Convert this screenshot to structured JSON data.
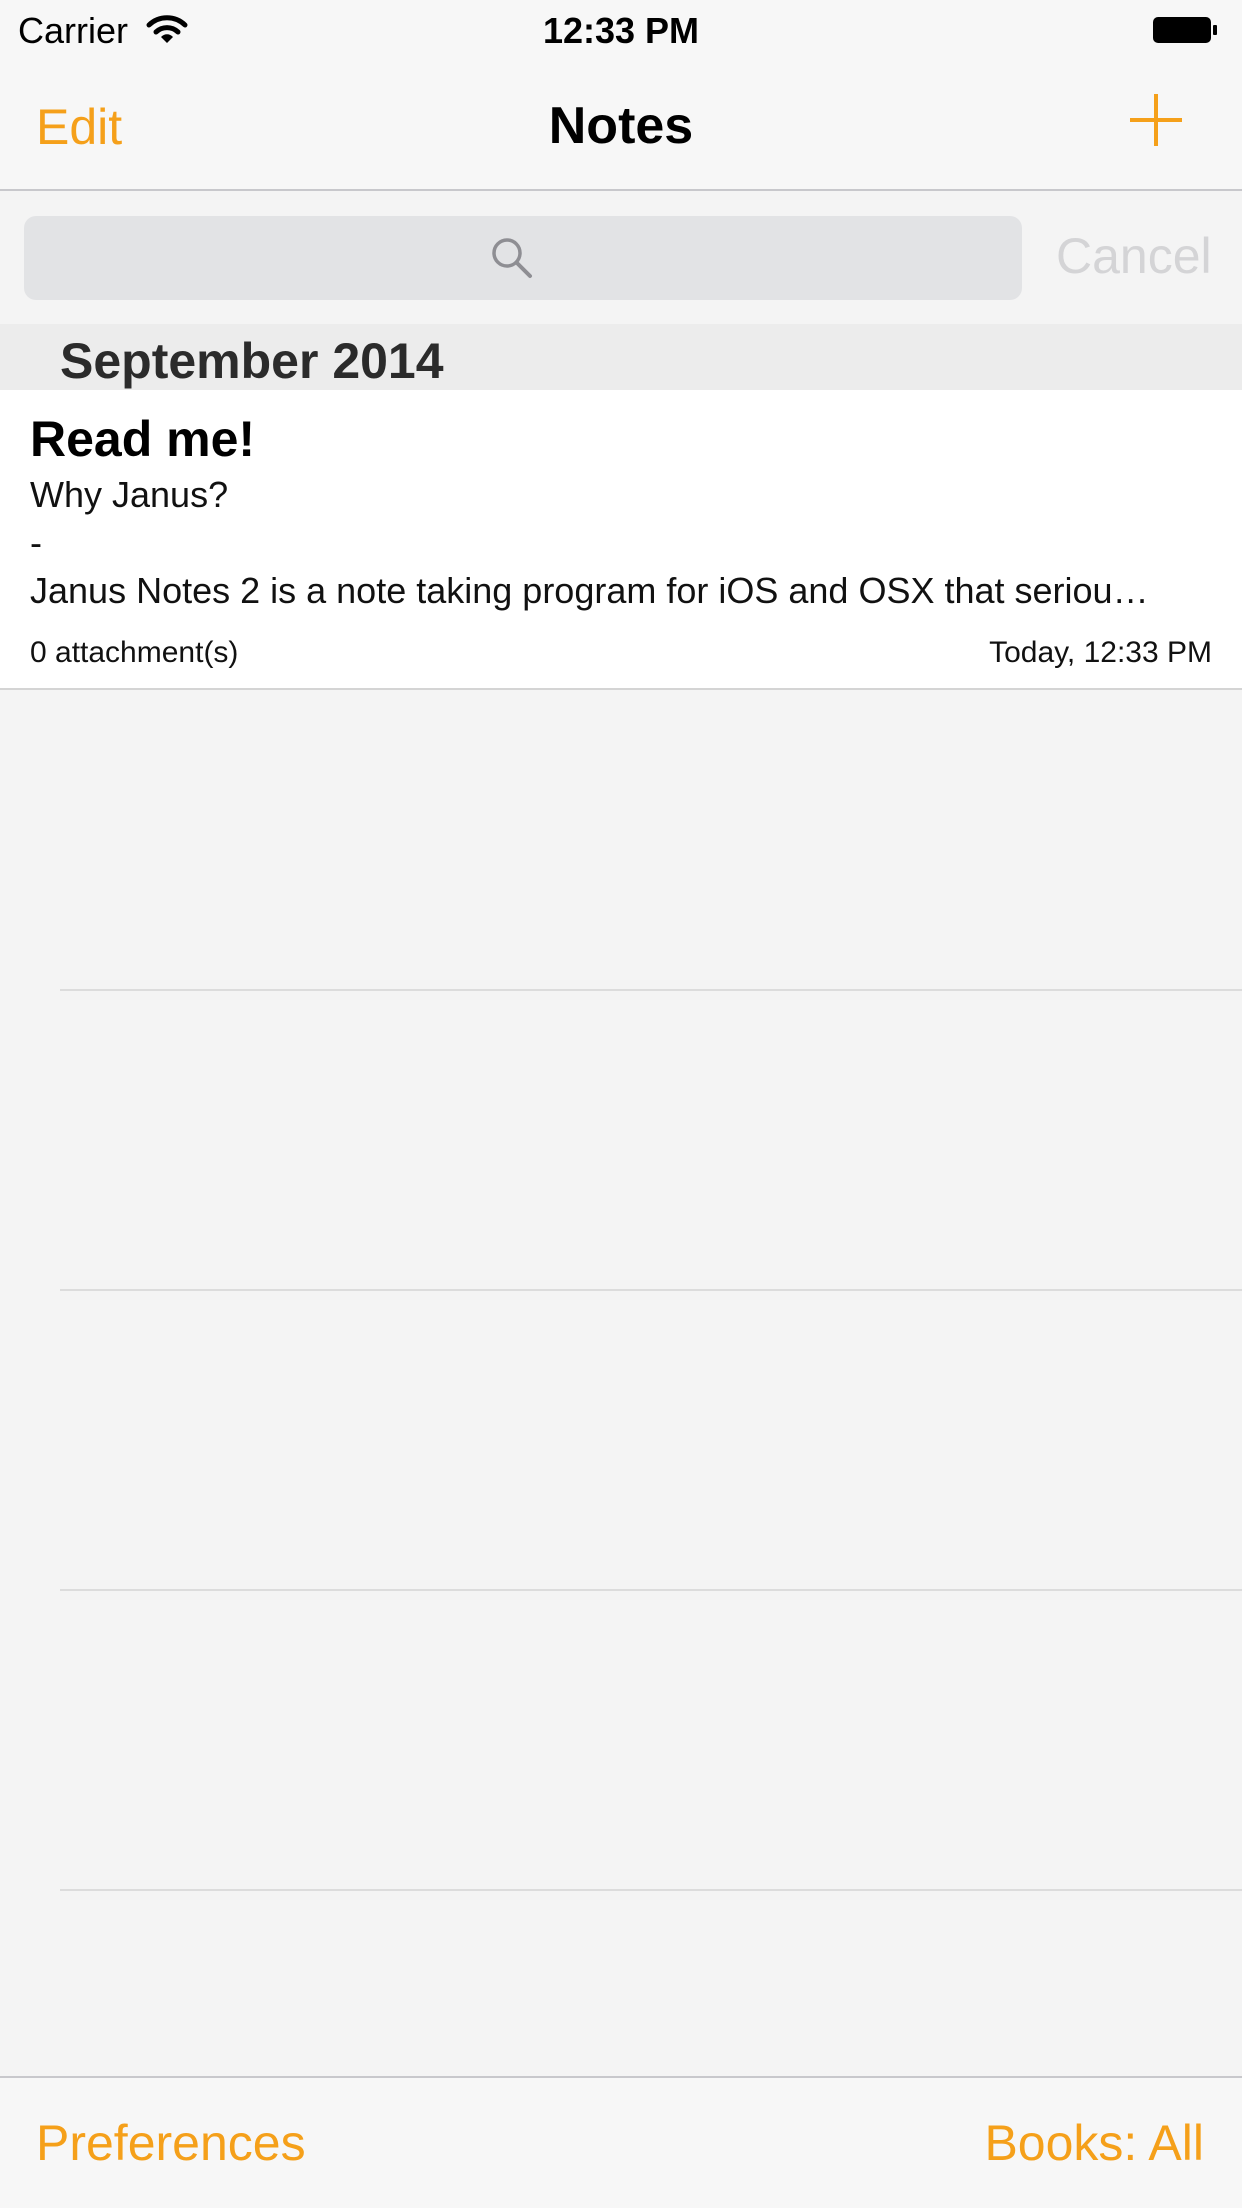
{
  "status_bar": {
    "carrier": "Carrier",
    "time": "12:33 PM"
  },
  "nav": {
    "left_label": "Edit",
    "title": "Notes",
    "right_icon": "plus-icon"
  },
  "search": {
    "placeholder": "",
    "cancel_label": "Cancel",
    "icon": "search-icon"
  },
  "section": {
    "title": "September 2014"
  },
  "notes": [
    {
      "title": "Read me!",
      "lines": [
        "Why Janus?",
        "-",
        "Janus Notes 2 is a note taking program for iOS and OSX that seriou…"
      ],
      "attachments": "0 attachment(s)",
      "date": "Today, 12:33 PM"
    }
  ],
  "toolbar": {
    "left_label": "Preferences",
    "right_label": "Books: All"
  },
  "colors": {
    "accent": "#f5a01a",
    "background": "#f4f4f4",
    "bar": "#f7f7f7"
  }
}
